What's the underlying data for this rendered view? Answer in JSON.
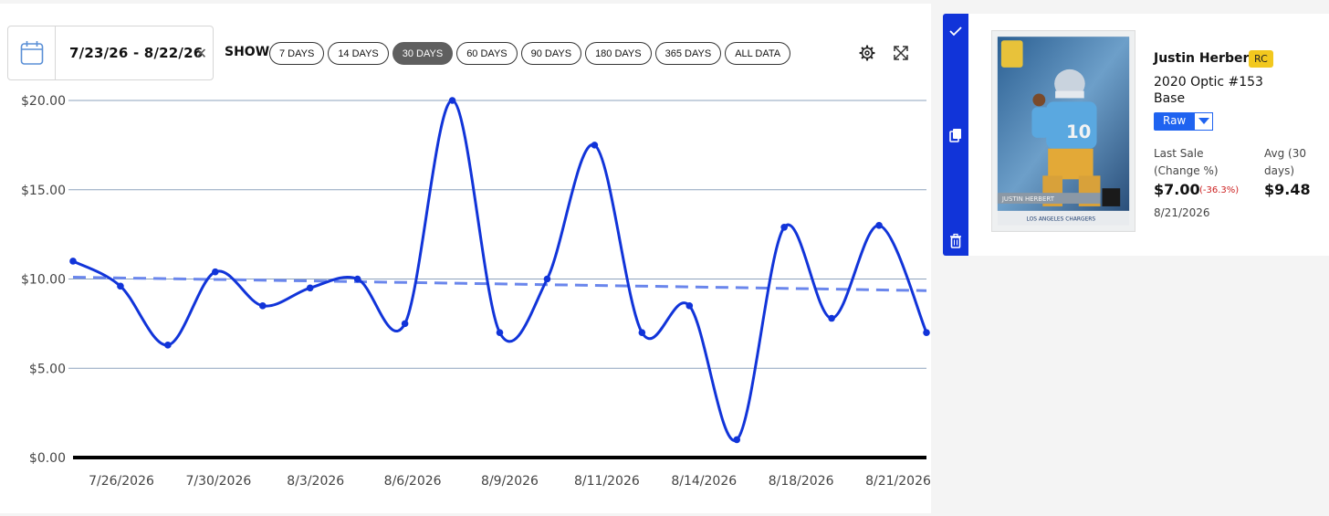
{
  "date_range": {
    "value": "7/23/26 - 8/22/26",
    "clear_icon": "close-icon"
  },
  "range_selector": {
    "label": "SHOW",
    "options": [
      "7 DAYS",
      "14 DAYS",
      "30 DAYS",
      "60 DAYS",
      "90 DAYS",
      "180 DAYS",
      "365 DAYS",
      "ALL DATA"
    ],
    "active": "30 DAYS"
  },
  "toolbar": {
    "settings_icon": "gear-icon",
    "expand_icon": "expand-icon"
  },
  "colors": {
    "series": "#1134d9",
    "trend": "#6a86ec",
    "sidebar": "#1134d9",
    "raw": "#1f63f0",
    "rc_badge": "#f2c81e",
    "change_negative": "#cc1f1f"
  },
  "sidebar": {
    "icons": [
      "check-icon",
      "copy-icon",
      "trash-icon"
    ]
  },
  "card": {
    "player": "Justin Herbert",
    "badge": "RC",
    "set": "2020 Optic #153",
    "variant": "Base",
    "grade": "Raw",
    "last_sale_label": "Last Sale (Change %)",
    "last_sale_price": "$7.00",
    "change_pct": "(-36.3%)",
    "avg_label": "Avg (30 days)",
    "avg_price": "$9.48",
    "sale_date": "8/21/2026",
    "image_text_name": "JUSTIN HERBERT",
    "image_text_team": "LOS ANGELES CHARGERS"
  },
  "chart_data": {
    "type": "line",
    "y_ticks": [
      "$0.00",
      "$5.00",
      "$10.00",
      "$15.00",
      "$20.00"
    ],
    "ylim": [
      0,
      20
    ],
    "x_ticks": [
      "7/26/2026",
      "7/30/2026",
      "8/3/2026",
      "8/6/2026",
      "8/9/2026",
      "8/11/2026",
      "8/14/2026",
      "8/18/2026",
      "8/21/2026"
    ],
    "grid": true,
    "series": [
      {
        "values": [
          11.0,
          9.6,
          6.3,
          10.4,
          8.5,
          9.5,
          10.0,
          7.5,
          20.0,
          7.0,
          10.0,
          17.5,
          7.0,
          8.5,
          1.0,
          12.9,
          7.8,
          13.0,
          7.0
        ]
      }
    ],
    "trendline": {
      "start": 10.1,
      "end": 9.35
    }
  }
}
